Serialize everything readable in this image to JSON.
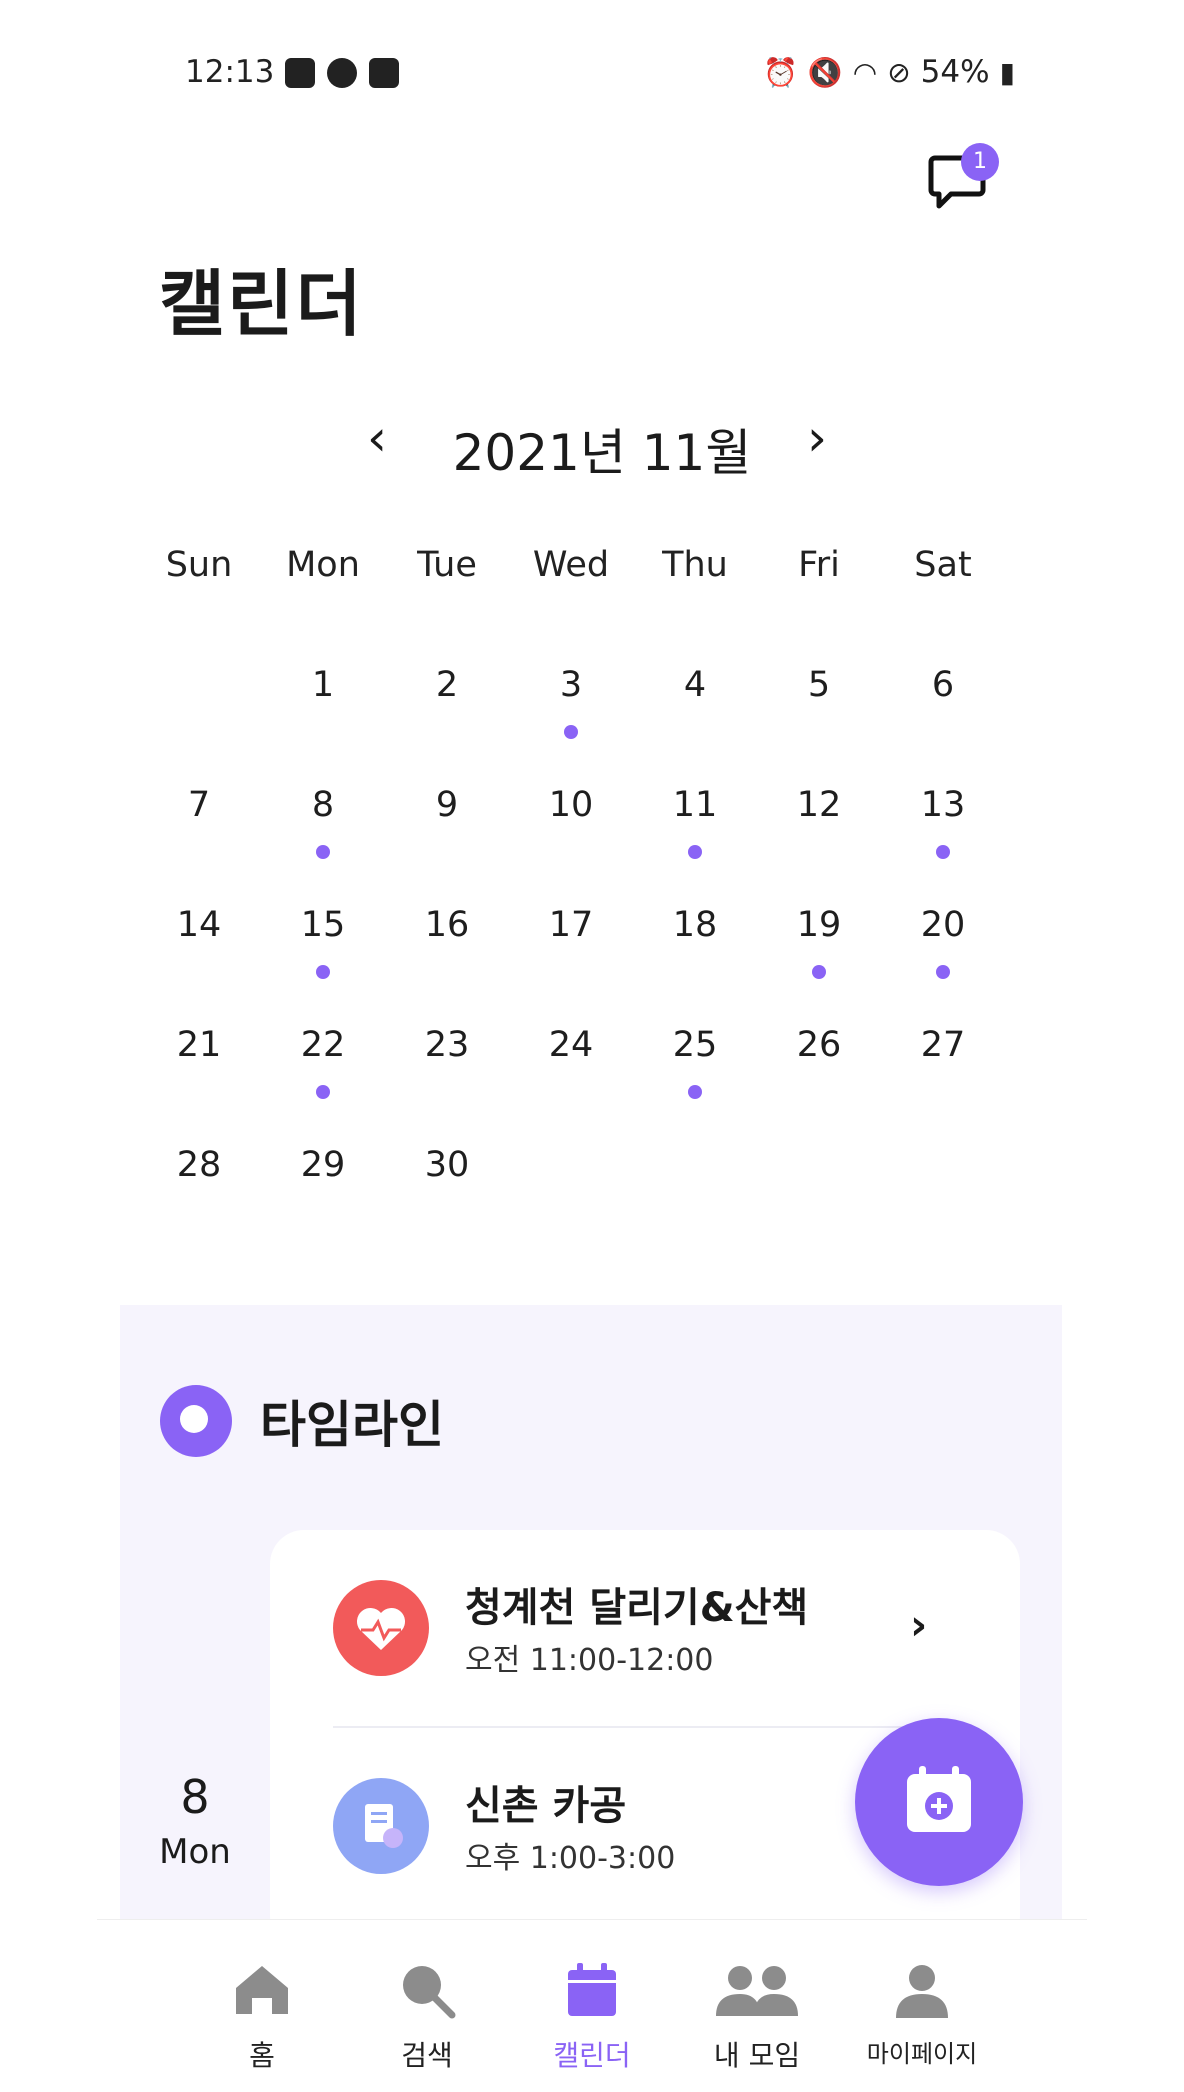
{
  "status_bar": {
    "time": "12:13",
    "battery": "54%"
  },
  "header": {
    "title": "캘린더",
    "notification_count": "1"
  },
  "calendar": {
    "month_label": "2021년 11월",
    "prev": "‹",
    "next": "›",
    "weekdays": [
      "Sun",
      "Mon",
      "Tue",
      "Wed",
      "Thu",
      "Fri",
      "Sat"
    ],
    "days": [
      {
        "day": "",
        "dot": false
      },
      {
        "day": "1",
        "dot": false
      },
      {
        "day": "2",
        "dot": false
      },
      {
        "day": "3",
        "dot": true
      },
      {
        "day": "4",
        "dot": false
      },
      {
        "day": "5",
        "dot": false
      },
      {
        "day": "6",
        "dot": false
      },
      {
        "day": "7",
        "dot": false
      },
      {
        "day": "8",
        "dot": true
      },
      {
        "day": "9",
        "dot": false
      },
      {
        "day": "10",
        "dot": false
      },
      {
        "day": "11",
        "dot": true
      },
      {
        "day": "12",
        "dot": false
      },
      {
        "day": "13",
        "dot": true
      },
      {
        "day": "14",
        "dot": false
      },
      {
        "day": "15",
        "dot": true
      },
      {
        "day": "16",
        "dot": false
      },
      {
        "day": "17",
        "dot": false
      },
      {
        "day": "18",
        "dot": false
      },
      {
        "day": "19",
        "dot": true
      },
      {
        "day": "20",
        "dot": true
      },
      {
        "day": "21",
        "dot": false
      },
      {
        "day": "22",
        "dot": true
      },
      {
        "day": "23",
        "dot": false
      },
      {
        "day": "24",
        "dot": false
      },
      {
        "day": "25",
        "dot": true
      },
      {
        "day": "26",
        "dot": false
      },
      {
        "day": "27",
        "dot": false
      },
      {
        "day": "28",
        "dot": false
      },
      {
        "day": "29",
        "dot": false
      },
      {
        "day": "30",
        "dot": false
      }
    ]
  },
  "timeline": {
    "title": "타임라인",
    "date": {
      "day": "8",
      "weekday": "Mon"
    },
    "events": [
      {
        "name": "청계천 달리기&산책",
        "time": "오전 11:00-12:00",
        "icon": "heart-icon",
        "color": "#f25a5a"
      },
      {
        "name": "신촌 카공",
        "time": "오후 1:00-3:00",
        "icon": "document-icon",
        "color": "#8fa6f5"
      }
    ]
  },
  "accent_color": "#8a63f5",
  "tabbar": {
    "items": [
      {
        "label": "홈",
        "icon": "home-icon",
        "active": false
      },
      {
        "label": "검색",
        "icon": "search-icon",
        "active": false
      },
      {
        "label": "캘린더",
        "icon": "calendar-icon",
        "active": true
      },
      {
        "label": "내 모임",
        "icon": "group-icon",
        "active": false
      },
      {
        "label": "마이페이지",
        "icon": "person-icon",
        "active": false
      }
    ]
  }
}
